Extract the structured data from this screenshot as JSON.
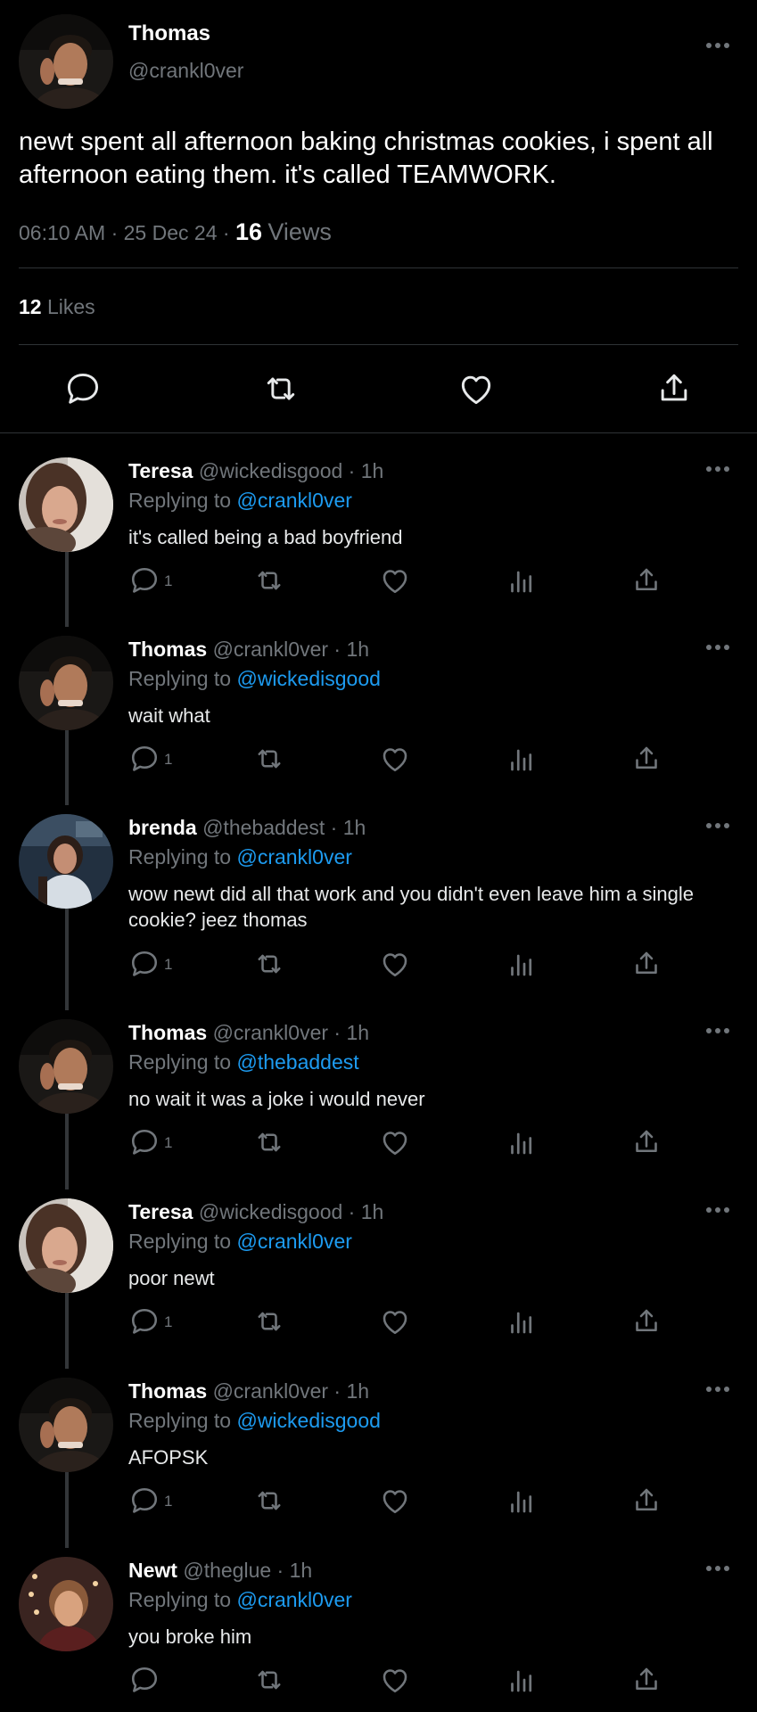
{
  "main_tweet": {
    "author_name": "Thomas",
    "author_handle": "@crankl0ver",
    "text": "newt spent all afternoon baking christmas cookies, i spent all afternoon eating them. it's called TEAMWORK.",
    "time": "06:10 AM",
    "date": "25 Dec 24",
    "views_count": "16",
    "views_label": "Views",
    "likes_count": "12",
    "likes_label": "Likes",
    "actions": [
      "reply-icon",
      "retweet-icon",
      "like-icon",
      "share-icon"
    ]
  },
  "replies": [
    {
      "name": "Teresa",
      "handle": "@wickedisgood",
      "time": "1h",
      "replying_label": "Replying to",
      "replying_to": "@crankl0ver",
      "text": "it's called being a bad boyfriend",
      "reply_count": "1",
      "avatar": "teresa"
    },
    {
      "name": "Thomas",
      "handle": "@crankl0ver",
      "time": "1h",
      "replying_label": "Replying to",
      "replying_to": "@wickedisgood",
      "text": "wait what",
      "reply_count": "1",
      "avatar": "thomas"
    },
    {
      "name": "brenda",
      "handle": "@thebaddest",
      "time": "1h",
      "replying_label": "Replying to",
      "replying_to": "@crankl0ver",
      "text": "wow newt did all that work and you didn't even leave him a single cookie? jeez thomas",
      "reply_count": "1",
      "avatar": "brenda"
    },
    {
      "name": "Thomas",
      "handle": "@crankl0ver",
      "time": "1h",
      "replying_label": "Replying to",
      "replying_to": "@thebaddest",
      "text": "no wait it was a joke i would never",
      "reply_count": "1",
      "avatar": "thomas"
    },
    {
      "name": "Teresa",
      "handle": "@wickedisgood",
      "time": "1h",
      "replying_label": "Replying to",
      "replying_to": "@crankl0ver",
      "text": "poor newt",
      "reply_count": "1",
      "avatar": "teresa"
    },
    {
      "name": "Thomas",
      "handle": "@crankl0ver",
      "time": "1h",
      "replying_label": "Replying to",
      "replying_to": "@wickedisgood",
      "text": "AFOPSK",
      "reply_count": "1",
      "avatar": "thomas"
    },
    {
      "name": "Newt",
      "handle": "@theglue",
      "time": "1h",
      "replying_label": "Replying to",
      "replying_to": "@crankl0ver",
      "text": "you broke him",
      "reply_count": "",
      "avatar": "newt"
    }
  ],
  "colors": {
    "background": "#000000",
    "text": "#e7e9ea",
    "muted": "#71767b",
    "link": "#1d9bf0",
    "divider": "#2f3336"
  }
}
